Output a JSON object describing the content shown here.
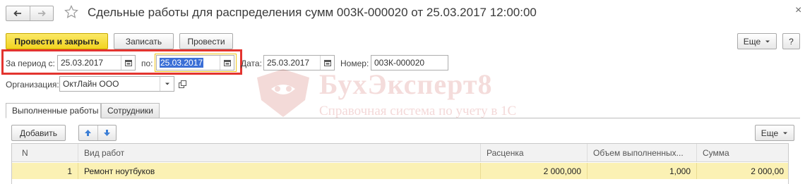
{
  "header": {
    "title": "Сдельные работы для распределения сумм 003К-000020 от 25.03.2017 12:00:00",
    "close_symbol": "×"
  },
  "toolbar": {
    "post_and_close": "Провести и закрыть",
    "save": "Записать",
    "post": "Провести",
    "more": "Еще",
    "help": "?"
  },
  "form": {
    "period_from_label": "За период с:",
    "period_from_value": "25.03.2017",
    "period_to_label": "по:",
    "period_to_value": "25.03.2017",
    "date_label": "Дата:",
    "date_value": "25.03.2017",
    "number_label": "Номер:",
    "number_value": "003К-000020",
    "org_label": "Организация:",
    "org_value": "ОктЛайн ООО"
  },
  "watermark": {
    "title": "БухЭксперт8",
    "subtitle": "Справочная система по учету в 1С"
  },
  "tabs": [
    {
      "label": "Выполненные работы",
      "active": true
    },
    {
      "label": "Сотрудники",
      "active": false
    }
  ],
  "table_toolbar": {
    "add": "Добавить",
    "more": "Еще"
  },
  "table": {
    "columns": [
      "N",
      "Вид работ",
      "Расценка",
      "Объем выполненных...",
      "Сумма"
    ],
    "rows": [
      [
        "1",
        "Ремонт ноутбуков",
        "2 000,000",
        "1,000",
        "2 000,00"
      ]
    ]
  },
  "colors": {
    "primary_button": "#f2d41f",
    "highlight_frame": "#e3342f",
    "selected_row": "#fbf1b4",
    "arrow_icons": "#3d7fd6"
  }
}
